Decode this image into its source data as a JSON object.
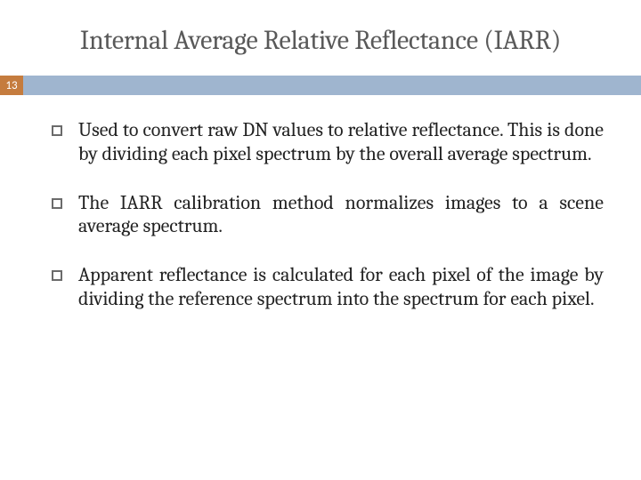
{
  "title": "Internal Average Relative Reflectance (IARR)",
  "slide_number": "13",
  "bullets": [
    "Used to convert raw DN values to relative reflectance. This is done by dividing each pixel spectrum by the overall average spectrum.",
    "The IARR calibration method normalizes images to a scene average spectrum.",
    "Apparent reflectance is calculated for each pixel of the image by dividing the reference spectrum into the spectrum for each pixel."
  ]
}
